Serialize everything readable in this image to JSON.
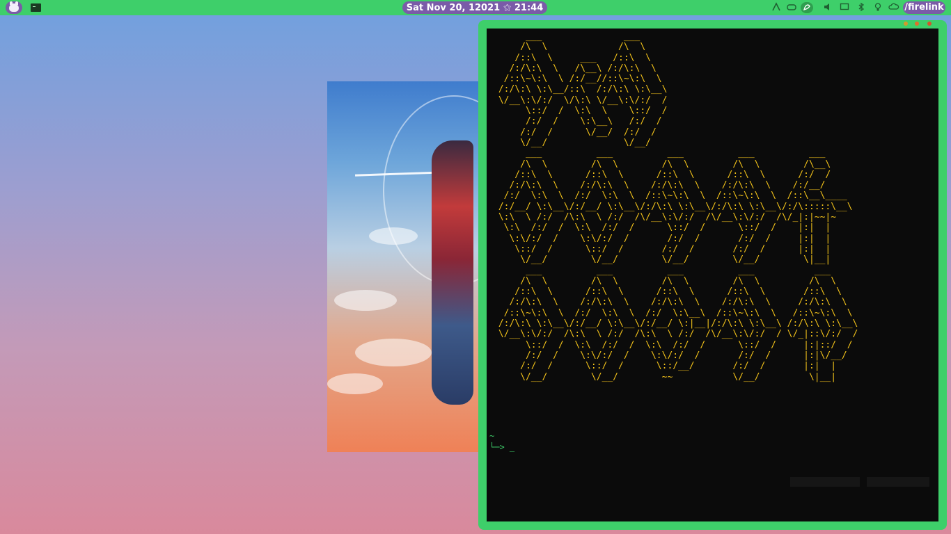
{
  "topbar": {
    "date": "Sat Nov 20, 12021",
    "separator": "⚝",
    "time": "21:44",
    "workspace": "/firelink",
    "icons": [
      "puppy-launcher-icon",
      "terminal-icon",
      "network-icon",
      "gamepad-icon",
      "stylus-icon",
      "volume-icon",
      "display-icon",
      "bluetooth-icon",
      "lightbulb-icon",
      "cloud-icon"
    ]
  },
  "terminal": {
    "ascii_art": "      ___               ___\n     /\\  \\             /\\  \\\n    /::\\  \\     ___   /::\\  \\\n   /:/\\:\\  \\   /\\__\\ /:/\\:\\  \\\n  /::\\~\\:\\  \\ /:/__//::\\~\\:\\  \\\n /:/\\:\\ \\:\\__/::\\  /:/\\:\\ \\:\\__\\\n \\/__\\:\\/:/  \\/\\:\\ \\/__\\:\\/:/  /\n      \\::/  /  \\:\\  \\    \\::/  /\n      /:/  /    \\:\\__\\   /:/  /\n     /:/  /      \\/__/  /:/  /\n     \\/__/              \\/__/\n      ___          ___          ___          ___          ___\n     /\\  \\        /\\  \\        /\\  \\        /\\  \\        /\\__\\\n    /::\\  \\      /::\\  \\      /::\\  \\      /::\\  \\      /:/  /\n   /:/\\:\\  \\    /:/\\:\\  \\    /:/\\:\\  \\    /:/\\:\\  \\    /:/__/\n  /:/  \\:\\  \\  /:/  \\:\\  \\  /::\\~\\:\\  \\  /::\\~\\:\\  \\  /::\\__\\____\n /:/__/ \\:\\__\\/:/__/ \\:\\__\\/:/\\:\\ \\:\\__\\/:/\\:\\ \\:\\__\\/:/\\:::::\\__\\\n \\:\\  \\ /:/  /\\:\\  \\ /:/  /\\/__\\:\\/:/  /\\/__\\:\\/:/  /\\/_|:|~~|~\n  \\:\\  /:/  /  \\:\\  /:/  /      \\::/  /      \\::/  /    |:|  |\n   \\:\\/:/  /    \\:\\/:/  /       /:/  /       /:/  /     |:|  |\n    \\::/  /      \\::/  /       /:/  /       /:/  /      |:|  |\n     \\/__/        \\/__/        \\/__/        \\/__/        \\|__|\n      ___          ___          ___          ___           ___\n     /\\  \\        /\\  \\        /\\  \\        /\\  \\         /\\  \\\n    /::\\  \\      /::\\  \\      /::\\  \\      /::\\  \\       /::\\  \\\n   /:/\\:\\  \\    /:/\\:\\  \\    /:/\\:\\  \\    /:/\\:\\  \\     /:/\\:\\  \\\n  /::\\~\\:\\  \\  /:/  \\:\\  \\  /:/  \\:\\__\\  /::\\~\\:\\  \\   /::\\~\\:\\  \\\n /:/\\:\\ \\:\\__\\/:/__/ \\:\\__\\/:/__/ \\:|__|/:/\\:\\ \\:\\__\\ /:/\\:\\ \\:\\__\\\n \\/__\\:\\/:/  /\\:\\  \\ /:/  /\\:\\  \\ /:/  /\\/__\\:\\/:/  / \\/_|::\\/:/  /\n      \\::/  /  \\:\\  /:/  /  \\:\\  /:/  /      \\::/  /     |:|::/  /\n      /:/  /    \\:\\/:/  /    \\:\\/:/  /       /:/  /      |:|\\/__/\n     /:/  /      \\::/  /      \\::/__/       /:/  /       |:|  |\n     \\/__/        \\/__/        ~~           \\/__/         \\|__|",
    "prompt_dir": "~",
    "prompt_arrow": "└─> ",
    "cursor": "_"
  },
  "colors": {
    "bar_green": "#3ecf6a",
    "pill_purple": "#7a5ba8",
    "ascii_yellow": "#f2c21a",
    "prompt_green": "#3ecf6a"
  }
}
